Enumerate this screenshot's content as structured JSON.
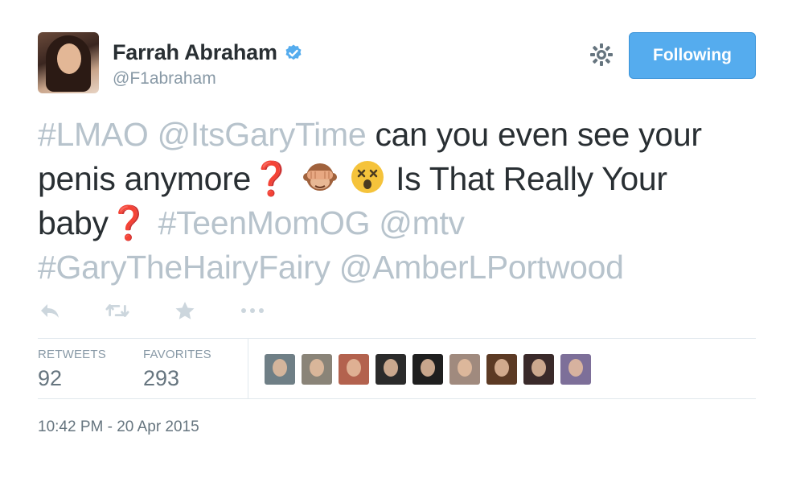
{
  "user": {
    "name": "Farrah Abraham",
    "handle": "@F1abraham",
    "verified": true
  },
  "header": {
    "follow_button_label": "Following"
  },
  "tweet": {
    "line1_hashtag": "#LMAO",
    "line1_mention": "@ItsGaryTime",
    "line1_text": "can you even see your",
    "line2_text_a": "penis anymore",
    "line2_emoji_q": "❓",
    "line2_text_b": "Is That Really Your",
    "line3_text": "baby",
    "line3_emoji_q": "❓",
    "line3_hashtag": "#TeenMomOG",
    "line3_mention": "@mtv",
    "line4_hashtag": "#GaryTheHairyFairy",
    "line4_mention": "@AmberLPortwood",
    "emojis": [
      "see-no-evil-monkey",
      "dizzy-face"
    ]
  },
  "actions": [
    "reply-icon",
    "retweet-icon",
    "favorite-star-icon",
    "more-dots-icon"
  ],
  "stats": {
    "retweets_label": "RETWEETS",
    "retweets_value": "92",
    "favorites_label": "FAVORITES",
    "favorites_value": "293"
  },
  "favoriters": [
    {
      "color": "#6f7f86"
    },
    {
      "color": "#8a8478"
    },
    {
      "color": "#b3624e"
    },
    {
      "color": "#2b2b2b"
    },
    {
      "color": "#1f1f1f"
    },
    {
      "color": "#a08a7e"
    },
    {
      "color": "#5c3a24"
    },
    {
      "color": "#3a2a2a"
    },
    {
      "color": "#7d6f99"
    }
  ],
  "timestamp": "10:42 PM - 20 Apr 2015",
  "colors": {
    "link": "#b7c3cc",
    "follow_button": "#55acee",
    "verified": "#55acee",
    "muted": "#8899a6",
    "question_mark": "#d0112b"
  }
}
